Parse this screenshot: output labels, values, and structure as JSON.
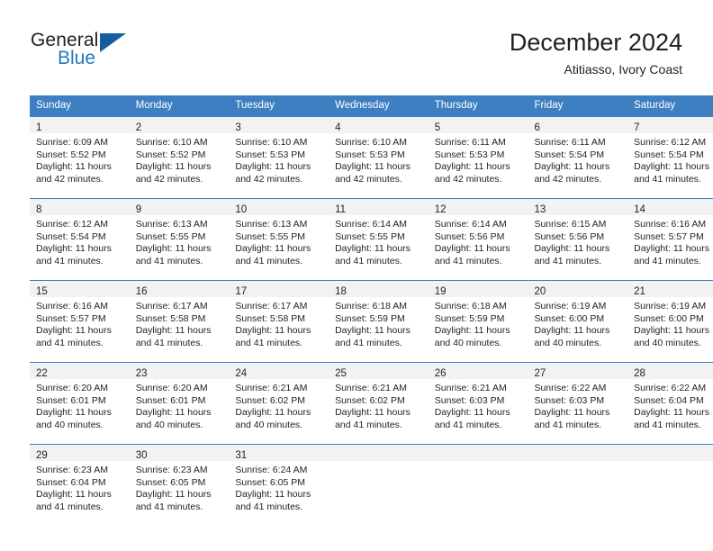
{
  "logo": {
    "word_top": "General",
    "word_bottom": "Blue",
    "triangle_color": "#155d9c",
    "blue_color": "#2079c3"
  },
  "header": {
    "title": "December 2024",
    "subtitle": "Atitiasso, Ivory Coast"
  },
  "theme": {
    "header_bg": "#3d7fc1",
    "header_text": "#ffffff",
    "daynum_band_bg": "#f2f2f2",
    "cell_bg": "#ffffff",
    "text": "#231f20"
  },
  "weekday_headers": [
    "Sunday",
    "Monday",
    "Tuesday",
    "Wednesday",
    "Thursday",
    "Friday",
    "Saturday"
  ],
  "weeks": [
    [
      {
        "day": "1",
        "sunrise": "Sunrise: 6:09 AM",
        "sunset": "Sunset: 5:52 PM",
        "daylight1": "Daylight: 11 hours",
        "daylight2": "and 42 minutes."
      },
      {
        "day": "2",
        "sunrise": "Sunrise: 6:10 AM",
        "sunset": "Sunset: 5:52 PM",
        "daylight1": "Daylight: 11 hours",
        "daylight2": "and 42 minutes."
      },
      {
        "day": "3",
        "sunrise": "Sunrise: 6:10 AM",
        "sunset": "Sunset: 5:53 PM",
        "daylight1": "Daylight: 11 hours",
        "daylight2": "and 42 minutes."
      },
      {
        "day": "4",
        "sunrise": "Sunrise: 6:10 AM",
        "sunset": "Sunset: 5:53 PM",
        "daylight1": "Daylight: 11 hours",
        "daylight2": "and 42 minutes."
      },
      {
        "day": "5",
        "sunrise": "Sunrise: 6:11 AM",
        "sunset": "Sunset: 5:53 PM",
        "daylight1": "Daylight: 11 hours",
        "daylight2": "and 42 minutes."
      },
      {
        "day": "6",
        "sunrise": "Sunrise: 6:11 AM",
        "sunset": "Sunset: 5:54 PM",
        "daylight1": "Daylight: 11 hours",
        "daylight2": "and 42 minutes."
      },
      {
        "day": "7",
        "sunrise": "Sunrise: 6:12 AM",
        "sunset": "Sunset: 5:54 PM",
        "daylight1": "Daylight: 11 hours",
        "daylight2": "and 41 minutes."
      }
    ],
    [
      {
        "day": "8",
        "sunrise": "Sunrise: 6:12 AM",
        "sunset": "Sunset: 5:54 PM",
        "daylight1": "Daylight: 11 hours",
        "daylight2": "and 41 minutes."
      },
      {
        "day": "9",
        "sunrise": "Sunrise: 6:13 AM",
        "sunset": "Sunset: 5:55 PM",
        "daylight1": "Daylight: 11 hours",
        "daylight2": "and 41 minutes."
      },
      {
        "day": "10",
        "sunrise": "Sunrise: 6:13 AM",
        "sunset": "Sunset: 5:55 PM",
        "daylight1": "Daylight: 11 hours",
        "daylight2": "and 41 minutes."
      },
      {
        "day": "11",
        "sunrise": "Sunrise: 6:14 AM",
        "sunset": "Sunset: 5:55 PM",
        "daylight1": "Daylight: 11 hours",
        "daylight2": "and 41 minutes."
      },
      {
        "day": "12",
        "sunrise": "Sunrise: 6:14 AM",
        "sunset": "Sunset: 5:56 PM",
        "daylight1": "Daylight: 11 hours",
        "daylight2": "and 41 minutes."
      },
      {
        "day": "13",
        "sunrise": "Sunrise: 6:15 AM",
        "sunset": "Sunset: 5:56 PM",
        "daylight1": "Daylight: 11 hours",
        "daylight2": "and 41 minutes."
      },
      {
        "day": "14",
        "sunrise": "Sunrise: 6:16 AM",
        "sunset": "Sunset: 5:57 PM",
        "daylight1": "Daylight: 11 hours",
        "daylight2": "and 41 minutes."
      }
    ],
    [
      {
        "day": "15",
        "sunrise": "Sunrise: 6:16 AM",
        "sunset": "Sunset: 5:57 PM",
        "daylight1": "Daylight: 11 hours",
        "daylight2": "and 41 minutes."
      },
      {
        "day": "16",
        "sunrise": "Sunrise: 6:17 AM",
        "sunset": "Sunset: 5:58 PM",
        "daylight1": "Daylight: 11 hours",
        "daylight2": "and 41 minutes."
      },
      {
        "day": "17",
        "sunrise": "Sunrise: 6:17 AM",
        "sunset": "Sunset: 5:58 PM",
        "daylight1": "Daylight: 11 hours",
        "daylight2": "and 41 minutes."
      },
      {
        "day": "18",
        "sunrise": "Sunrise: 6:18 AM",
        "sunset": "Sunset: 5:59 PM",
        "daylight1": "Daylight: 11 hours",
        "daylight2": "and 41 minutes."
      },
      {
        "day": "19",
        "sunrise": "Sunrise: 6:18 AM",
        "sunset": "Sunset: 5:59 PM",
        "daylight1": "Daylight: 11 hours",
        "daylight2": "and 40 minutes."
      },
      {
        "day": "20",
        "sunrise": "Sunrise: 6:19 AM",
        "sunset": "Sunset: 6:00 PM",
        "daylight1": "Daylight: 11 hours",
        "daylight2": "and 40 minutes."
      },
      {
        "day": "21",
        "sunrise": "Sunrise: 6:19 AM",
        "sunset": "Sunset: 6:00 PM",
        "daylight1": "Daylight: 11 hours",
        "daylight2": "and 40 minutes."
      }
    ],
    [
      {
        "day": "22",
        "sunrise": "Sunrise: 6:20 AM",
        "sunset": "Sunset: 6:01 PM",
        "daylight1": "Daylight: 11 hours",
        "daylight2": "and 40 minutes."
      },
      {
        "day": "23",
        "sunrise": "Sunrise: 6:20 AM",
        "sunset": "Sunset: 6:01 PM",
        "daylight1": "Daylight: 11 hours",
        "daylight2": "and 40 minutes."
      },
      {
        "day": "24",
        "sunrise": "Sunrise: 6:21 AM",
        "sunset": "Sunset: 6:02 PM",
        "daylight1": "Daylight: 11 hours",
        "daylight2": "and 40 minutes."
      },
      {
        "day": "25",
        "sunrise": "Sunrise: 6:21 AM",
        "sunset": "Sunset: 6:02 PM",
        "daylight1": "Daylight: 11 hours",
        "daylight2": "and 41 minutes."
      },
      {
        "day": "26",
        "sunrise": "Sunrise: 6:21 AM",
        "sunset": "Sunset: 6:03 PM",
        "daylight1": "Daylight: 11 hours",
        "daylight2": "and 41 minutes."
      },
      {
        "day": "27",
        "sunrise": "Sunrise: 6:22 AM",
        "sunset": "Sunset: 6:03 PM",
        "daylight1": "Daylight: 11 hours",
        "daylight2": "and 41 minutes."
      },
      {
        "day": "28",
        "sunrise": "Sunrise: 6:22 AM",
        "sunset": "Sunset: 6:04 PM",
        "daylight1": "Daylight: 11 hours",
        "daylight2": "and 41 minutes."
      }
    ],
    [
      {
        "day": "29",
        "sunrise": "Sunrise: 6:23 AM",
        "sunset": "Sunset: 6:04 PM",
        "daylight1": "Daylight: 11 hours",
        "daylight2": "and 41 minutes."
      },
      {
        "day": "30",
        "sunrise": "Sunrise: 6:23 AM",
        "sunset": "Sunset: 6:05 PM",
        "daylight1": "Daylight: 11 hours",
        "daylight2": "and 41 minutes."
      },
      {
        "day": "31",
        "sunrise": "Sunrise: 6:24 AM",
        "sunset": "Sunset: 6:05 PM",
        "daylight1": "Daylight: 11 hours",
        "daylight2": "and 41 minutes."
      },
      {
        "day": "",
        "sunrise": "",
        "sunset": "",
        "daylight1": "",
        "daylight2": ""
      },
      {
        "day": "",
        "sunrise": "",
        "sunset": "",
        "daylight1": "",
        "daylight2": ""
      },
      {
        "day": "",
        "sunrise": "",
        "sunset": "",
        "daylight1": "",
        "daylight2": ""
      },
      {
        "day": "",
        "sunrise": "",
        "sunset": "",
        "daylight1": "",
        "daylight2": ""
      }
    ]
  ]
}
